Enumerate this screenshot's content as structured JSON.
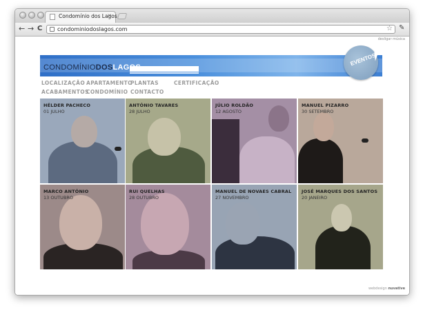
{
  "browser": {
    "tab_title": "Condomínio dos Lagos",
    "tab_close": "×",
    "url": "condominiodoslagos.com",
    "back_icon": "back-arrow-icon",
    "forward_icon": "forward-arrow-icon",
    "reload_icon": "reload-icon",
    "back_glyph": "←",
    "forward_glyph": "→",
    "reload_glyph": "C",
    "star_glyph": "☆",
    "wrench_glyph": "✎"
  },
  "page": {
    "music_toggle": "desligar música",
    "logo": {
      "part1": "CONDOMÍNIO",
      "part2": "DOS",
      "part3": "LAGOS"
    },
    "badge": "EVENTOS",
    "menu": [
      {
        "label": "LOCALIZAÇÃO"
      },
      {
        "label": "APARTAMENTO"
      },
      {
        "label": "PLANTAS"
      },
      {
        "label": "CERTIFICAÇÃO"
      },
      {
        "label": "ACABAMENTOS"
      },
      {
        "label": "CONDOMÍNIO"
      },
      {
        "label": "CONTACTO"
      }
    ],
    "events": [
      {
        "name": "HÉLDER PACHECO",
        "date": "01 JULHO",
        "tint": "#9aa8bb"
      },
      {
        "name": "ANTÓNIO TAVARES",
        "date": "28 JULHO",
        "tint": "#a6a98a"
      },
      {
        "name": "JÚLIO ROLDÃO",
        "date": "12 AGOSTO",
        "tint": "#a48fa5"
      },
      {
        "name": "MANUEL PIZARRO",
        "date": "30 SETEMBRO",
        "tint": "#b9a89b"
      },
      {
        "name": "MARCO ANTÓNIO",
        "date": "13 OUTUBRO",
        "tint": "#9c8a89"
      },
      {
        "name": "RUI QUELHAS",
        "date": "28 OUTUBRO",
        "tint": "#a48b9c"
      },
      {
        "name": "MANUEL DE NOVAES CABRAL",
        "date": "27 NOVEMBRO",
        "tint": "#98a4b4"
      },
      {
        "name": "JOSÉ MARQUES DOS SANTOS",
        "date": "20 JANEIRO",
        "tint": "#a6a68b"
      }
    ],
    "footer": {
      "credit": "webdesign",
      "brand": "nuvative"
    }
  }
}
